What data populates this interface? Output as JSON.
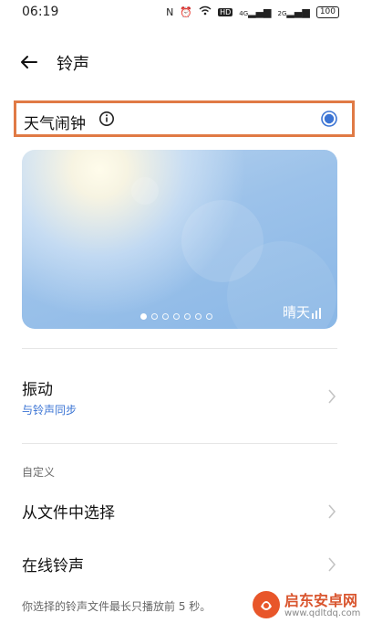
{
  "status_bar": {
    "time": "06:19",
    "nfc": "N",
    "network_hd": "HD",
    "net1": "4G",
    "net2": "2G",
    "battery": "100"
  },
  "header": {
    "title": "铃声"
  },
  "weather_alarm": {
    "label": "天气闹钟",
    "selected": true
  },
  "preview": {
    "weather_name": "晴天",
    "page_count": 7,
    "active_page": 0
  },
  "vibration": {
    "label": "振动",
    "subtitle": "与铃声同步"
  },
  "custom_section": {
    "header": "自定义",
    "choose_file_label": "从文件中选择",
    "online_ringtone_label": "在线铃声"
  },
  "footnote": "你选择的铃声文件最长只播放前 5 秒。",
  "watermark": {
    "title": "启东安卓网",
    "url": "www.qdltdq.com"
  },
  "colors": {
    "accent": "#3b74d4",
    "highlight_border": "#e07a45"
  }
}
